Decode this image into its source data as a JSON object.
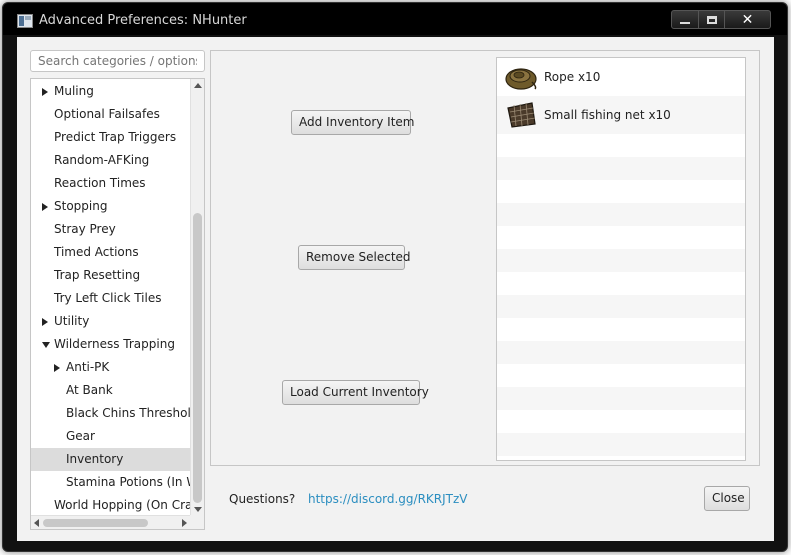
{
  "window": {
    "title": "Advanced Preferences: NHunter",
    "controls": {
      "minimize_icon": "minimize-icon",
      "maximize_icon": "maximize-icon",
      "close_glyph": "✕"
    }
  },
  "sidebar": {
    "search_placeholder": "Search categories / options",
    "items": [
      {
        "label": "Muling",
        "level": 0,
        "expandable": true,
        "expanded": false,
        "selected": false
      },
      {
        "label": "Optional Failsafes",
        "level": 0,
        "expandable": false,
        "expanded": false,
        "selected": false
      },
      {
        "label": "Predict Trap Triggers",
        "level": 0,
        "expandable": false,
        "expanded": false,
        "selected": false
      },
      {
        "label": "Random-AFKing",
        "level": 0,
        "expandable": false,
        "expanded": false,
        "selected": false
      },
      {
        "label": "Reaction Times",
        "level": 0,
        "expandable": false,
        "expanded": false,
        "selected": false
      },
      {
        "label": "Stopping",
        "level": 0,
        "expandable": true,
        "expanded": false,
        "selected": false
      },
      {
        "label": "Stray Prey",
        "level": 0,
        "expandable": false,
        "expanded": false,
        "selected": false
      },
      {
        "label": "Timed Actions",
        "level": 0,
        "expandable": false,
        "expanded": false,
        "selected": false
      },
      {
        "label": "Trap Resetting",
        "level": 0,
        "expandable": false,
        "expanded": false,
        "selected": false
      },
      {
        "label": "Try Left Click Tiles",
        "level": 0,
        "expandable": false,
        "expanded": false,
        "selected": false
      },
      {
        "label": "Utility",
        "level": 0,
        "expandable": true,
        "expanded": false,
        "selected": false
      },
      {
        "label": "Wilderness Trapping",
        "level": 0,
        "expandable": true,
        "expanded": true,
        "selected": false
      },
      {
        "label": "Anti-PK",
        "level": 1,
        "expandable": true,
        "expanded": false,
        "selected": false
      },
      {
        "label": "At Bank",
        "level": 1,
        "expandable": false,
        "expanded": false,
        "selected": false
      },
      {
        "label": "Black Chins Threshold",
        "level": 1,
        "expandable": false,
        "expanded": false,
        "selected": false
      },
      {
        "label": "Gear",
        "level": 1,
        "expandable": false,
        "expanded": false,
        "selected": false
      },
      {
        "label": "Inventory",
        "level": 1,
        "expandable": false,
        "expanded": false,
        "selected": true
      },
      {
        "label": "Stamina Potions (In Wilderness)",
        "level": 1,
        "expandable": false,
        "expanded": false,
        "selected": false
      },
      {
        "label": "World Hopping (On Crash)",
        "level": 0,
        "expandable": false,
        "expanded": false,
        "selected": false
      }
    ]
  },
  "main": {
    "add_button": "Add Inventory Item",
    "remove_button": "Remove Selected",
    "load_button": "Load Current Inventory",
    "inventory": [
      {
        "label": "Rope x10",
        "icon": "rope-icon",
        "color": "#6e5a2a"
      },
      {
        "label": "Small fishing net x10",
        "icon": "fishing-net-icon",
        "color": "#4a3a2a"
      }
    ]
  },
  "footer": {
    "questions_label": "Questions?",
    "discord_link": "https://discord.gg/RKRJTzV",
    "close_button": "Close"
  },
  "colors": {
    "titlebar": "#000000",
    "client_bg": "#f2f2f2",
    "selected_row": "#dcdcdc",
    "link": "#2b8ec0"
  }
}
